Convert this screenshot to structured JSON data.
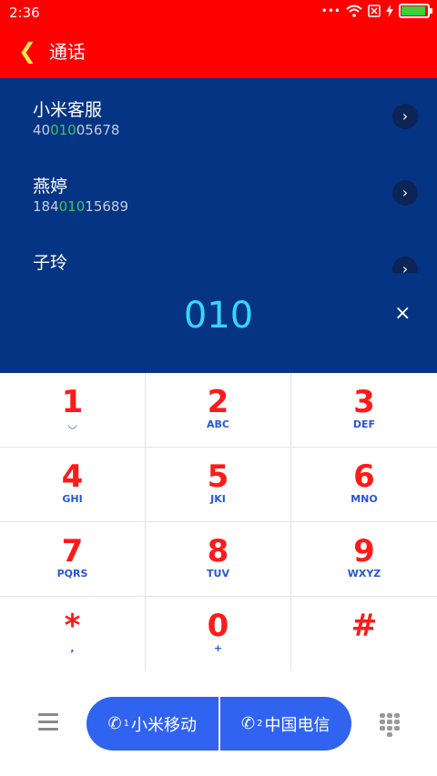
{
  "status": {
    "time": "2:36",
    "icons": [
      "dots-icon",
      "wifi-icon",
      "sim-x-icon",
      "charging-icon",
      "battery-icon"
    ],
    "battery_level": 1.0
  },
  "header": {
    "title": "通话",
    "back_icon": "back-chevron-icon"
  },
  "results": [
    {
      "name": "小米客服",
      "num_pre": "40",
      "num_hl": "010",
      "num_post": "05678"
    },
    {
      "name": "燕婷",
      "num_pre": "184",
      "num_hl": "010",
      "num_post": "15689"
    },
    {
      "name": "子玲",
      "num_pre": "",
      "num_hl": "",
      "num_post": ""
    }
  ],
  "dial": {
    "digits": "010",
    "clear": "×"
  },
  "keys": [
    {
      "d": "1",
      "l": "◡"
    },
    {
      "d": "2",
      "l": "ABC"
    },
    {
      "d": "3",
      "l": "DEF"
    },
    {
      "d": "4",
      "l": "GHI"
    },
    {
      "d": "5",
      "l": "JKI"
    },
    {
      "d": "6",
      "l": "MNO"
    },
    {
      "d": "7",
      "l": "PQRS"
    },
    {
      "d": "8",
      "l": "TUV"
    },
    {
      "d": "9",
      "l": "WXYZ"
    },
    {
      "d": "*",
      "l": ","
    },
    {
      "d": "0",
      "l": "+"
    },
    {
      "d": "#",
      "l": ""
    }
  ],
  "bottom": {
    "sim1": {
      "icon": "✆",
      "slot": "1",
      "label": "小米移动"
    },
    "sim2": {
      "icon": "✆",
      "slot": "2",
      "label": "中国电信"
    }
  },
  "colors": {
    "status_bar": "#ff0000",
    "panel": "#063484",
    "digits": "#35d7ff",
    "key_digit": "#ff1a1a",
    "key_letters": "#2756d6",
    "sim_button": "#2f63f0"
  }
}
